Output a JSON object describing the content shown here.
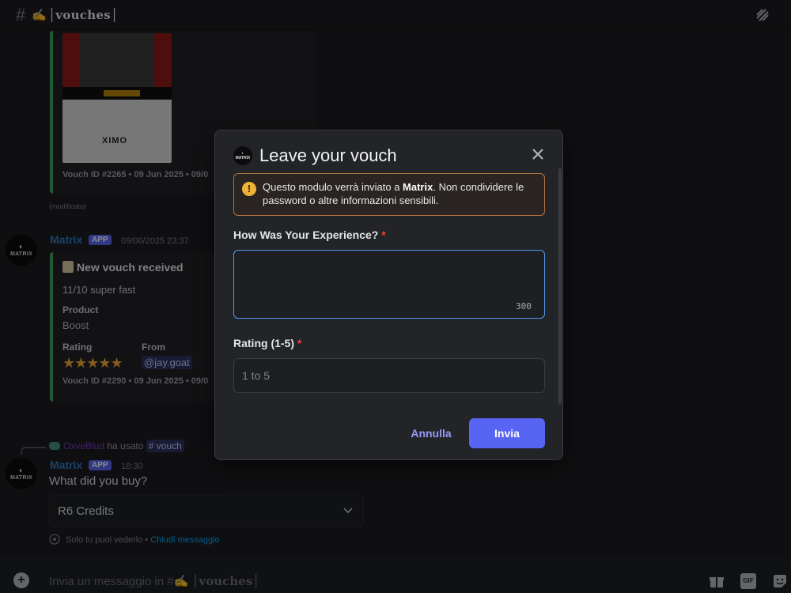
{
  "header": {
    "hash": "#",
    "channel_emoji": "✍",
    "channel_name": "│vouches│"
  },
  "messages": {
    "embed1": {
      "thumbnail_logo": "XIMO",
      "vouch_id": "Vouch ID #2265 • 09 Jun 2025 • 09/0",
      "edited": "(modificato)"
    },
    "message1": {
      "avatar_text": "MATRIX",
      "username": "Matrix",
      "badge": "APP",
      "timestamp": "09/06/2025 23:37",
      "embed": {
        "title": "New vouch received",
        "description": "11/10 super fast",
        "product_label": "Product",
        "product_value": "Boost",
        "rating_label": "Rating",
        "rating_value": 5,
        "rating_stars": "★★★★★",
        "from_label": "From",
        "from_value": "@jay.goat",
        "vouch_id": "Vouch ID #2290 • 09 Jun 2025 • 09/0"
      }
    },
    "command_use": {
      "user": "OxveBlud",
      "text": "ha usato",
      "command": "# vouch"
    },
    "message2": {
      "avatar_text": "MATRIX",
      "username": "Matrix",
      "badge": "APP",
      "timestamp": "18:30",
      "text": "What did you buy?",
      "select_value": "R6 Credits",
      "ephemeral_text": "Solo tu puoi vederlo •",
      "ephemeral_link": "Chiudi messaggio"
    }
  },
  "composer": {
    "placeholder_prefix": "Invia un messaggio in #",
    "placeholder_emoji": "✍",
    "placeholder_channel": "│vouches│",
    "gif_label": "GIF"
  },
  "modal": {
    "title": "Leave your vouch",
    "warning_pre": "Questo modulo verrà inviato a ",
    "warning_bold": "Matrix",
    "warning_post": ". Non condividere le password o altre informazioni sensibili.",
    "field1_label": "How Was Your Experience?",
    "field1_value": "",
    "field1_counter": "300",
    "field2_label": "Rating (1-5)",
    "field2_placeholder": "1 to 5",
    "required_mark": "*",
    "cancel_label": "Annulla",
    "submit_label": "Invia"
  },
  "colors": {
    "accent": "#5865f2",
    "embed_border": "#3ba55c",
    "warning_border": "#b27440",
    "username": "#2f7bc4"
  }
}
